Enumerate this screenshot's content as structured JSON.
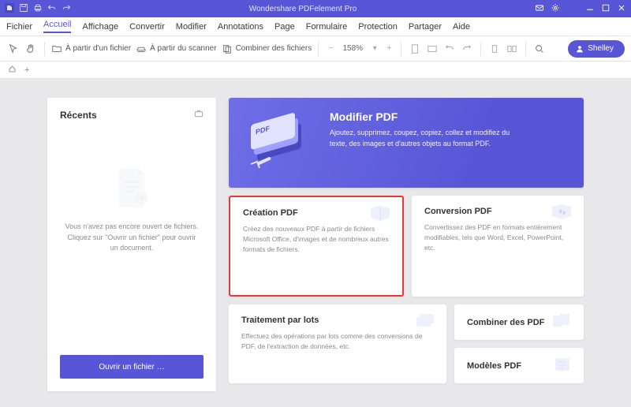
{
  "titlebar": {
    "title": "Wondershare PDFelement Pro"
  },
  "menu": {
    "items": [
      "Fichier",
      "Accueil",
      "Affichage",
      "Convertir",
      "Modifier",
      "Annotations",
      "Page",
      "Formulaire",
      "Protection",
      "Partager",
      "Aide"
    ],
    "activeIndex": 1
  },
  "toolbar": {
    "open_file": "À partir d'un fichier",
    "from_scanner": "À partir du scanner",
    "combine": "Combiner des fichiers",
    "zoom": "158%",
    "user": "Shelley"
  },
  "recents": {
    "title": "Récents",
    "empty_text": "Vous n'avez pas encore ouvert de fichiers. Cliquez sur \"Ouvrir un fichier\" pour ouvrir un document.",
    "open_button": "Ouvrir un fichier …"
  },
  "hero": {
    "title": "Modifier PDF",
    "desc": "Ajoutez, supprimez, coupez, copiez, collez et modifiez du texte, des images et d'autres objets au format PDF."
  },
  "cards": {
    "create": {
      "title": "Création PDF",
      "desc": "Créez des nouveaux PDF à partir de fichiers Microsoft Office, d'images et de nombreux autres formats de fichiers."
    },
    "convert": {
      "title": "Conversion PDF",
      "desc": "Convertissez des PDF en formats entièrement modifiables, tels que Word, Excel, PowerPoint, etc."
    },
    "batch": {
      "title": "Traitement par lots",
      "desc": "Effectuez des opérations par lots comme des conversions de PDF, de l'extraction de données, etc."
    },
    "combine": {
      "title": "Combiner des PDF"
    },
    "templates": {
      "title": "Modèles PDF"
    }
  },
  "colors": {
    "accent": "#5856d6",
    "highlight": "#e53935"
  }
}
